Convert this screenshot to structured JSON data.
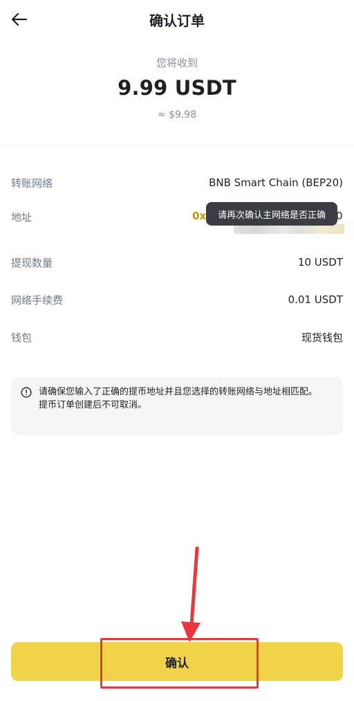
{
  "header": {
    "title": "确认订单"
  },
  "receive": {
    "label": "您将收到",
    "amount": "9.99 USDT",
    "fiat": "≈ $9.98"
  },
  "details": {
    "network": {
      "label": "转账网络",
      "value": "BNB Smart Chain (BEP20)"
    },
    "address": {
      "label": "地址",
      "prefix": "0x",
      "end": "0",
      "tooltip": "请再次确认主网络是否正确"
    },
    "amount": {
      "label": "提现数量",
      "value": "10 USDT"
    },
    "fee": {
      "label": "网络手续费",
      "value": "0.01 USDT"
    },
    "wallet": {
      "label": "钱包",
      "value": "现货钱包"
    }
  },
  "notice": {
    "line1": "请确保您输入了正确的提币地址并且您选择的转账网络与地址相匹配。",
    "line2": "提币订单创建后不可取消。"
  },
  "confirm": {
    "label": "确认"
  },
  "colors": {
    "accent": "#f0d348",
    "address": "#c99400",
    "highlight": "#e8383d"
  },
  "icons": {
    "back": "arrow-left-icon",
    "notice": "info-circle-icon"
  }
}
